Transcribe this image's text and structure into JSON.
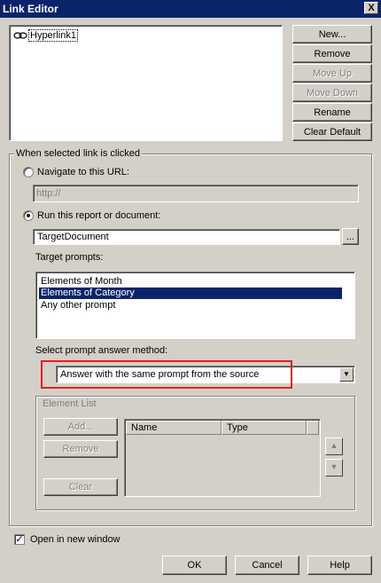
{
  "window": {
    "title": "Link Editor",
    "close_label": "X"
  },
  "links": {
    "items": [
      "Hyperlink1"
    ]
  },
  "link_buttons": {
    "new": "New...",
    "remove": "Remove",
    "move_up": "Move Up",
    "move_down": "Move Down",
    "rename": "Rename",
    "clear_default": "Clear Default"
  },
  "behavior": {
    "group_label": "When selected link is clicked",
    "navigate_label": "Navigate to this URL:",
    "url_value": "http://",
    "run_label": "Run this report or document:",
    "target_value": "TargetDocument",
    "browse_label": "...",
    "target_prompts_label": "Target prompts:",
    "prompts": [
      "Elements of Month",
      "Elements of Category",
      "Any other prompt"
    ],
    "selected_prompt": "Elements of Category",
    "method_label": "Select prompt answer method:",
    "method_value": "Answer with the same prompt from the source"
  },
  "element_list": {
    "group_label": "Element List",
    "add": "Add...",
    "remove": "Remove",
    "clear": "Clear",
    "columns": [
      "Name",
      "Type"
    ]
  },
  "footer": {
    "open_new_window": "Open in new window",
    "ok": "OK",
    "cancel": "Cancel",
    "help": "Help"
  },
  "colors": {
    "highlight": "#0a246a",
    "annotation_box": "#e02020"
  }
}
